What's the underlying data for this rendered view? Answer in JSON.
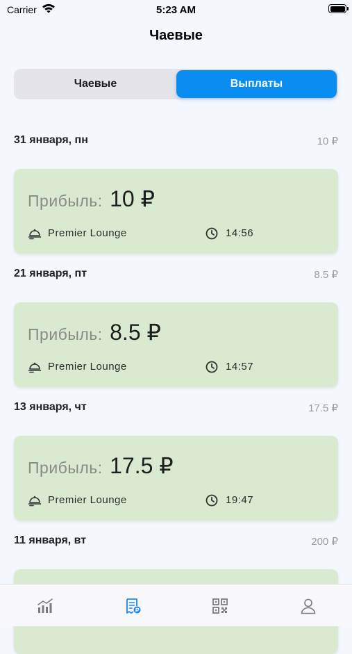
{
  "status_bar": {
    "carrier": "Carrier",
    "time": "5:23 AM"
  },
  "nav": {
    "title": "Чаевые"
  },
  "segments": {
    "left": "Чаевые",
    "right": "Выплаты",
    "selected": "right"
  },
  "profit_label": "Прибыль:",
  "days": [
    {
      "date": "31 января, пн",
      "total": "10 ₽",
      "amount": "10 ₽",
      "venue": "Premier Lounge",
      "time": "14:56"
    },
    {
      "date": "21 января, пт",
      "total": "8.5 ₽",
      "amount": "8.5 ₽",
      "venue": "Premier Lounge",
      "time": "14:57"
    },
    {
      "date": "13 января, чт",
      "total": "17.5 ₽",
      "amount": "17.5 ₽",
      "venue": "Premier Lounge",
      "time": "19:47"
    },
    {
      "date": "11 января, вт",
      "total": "200 ₽"
    }
  ],
  "tabbar": {
    "items": [
      {
        "icon": "chart-icon",
        "active": false
      },
      {
        "icon": "receipt-icon",
        "active": true
      },
      {
        "icon": "qr-code-icon",
        "active": false
      },
      {
        "icon": "profile-icon",
        "active": false
      }
    ],
    "active_color": "#1a8ae8",
    "inactive_color": "#7a7a80"
  },
  "colors": {
    "accent": "#0a8df0",
    "card_bg": "#d9ead0"
  }
}
